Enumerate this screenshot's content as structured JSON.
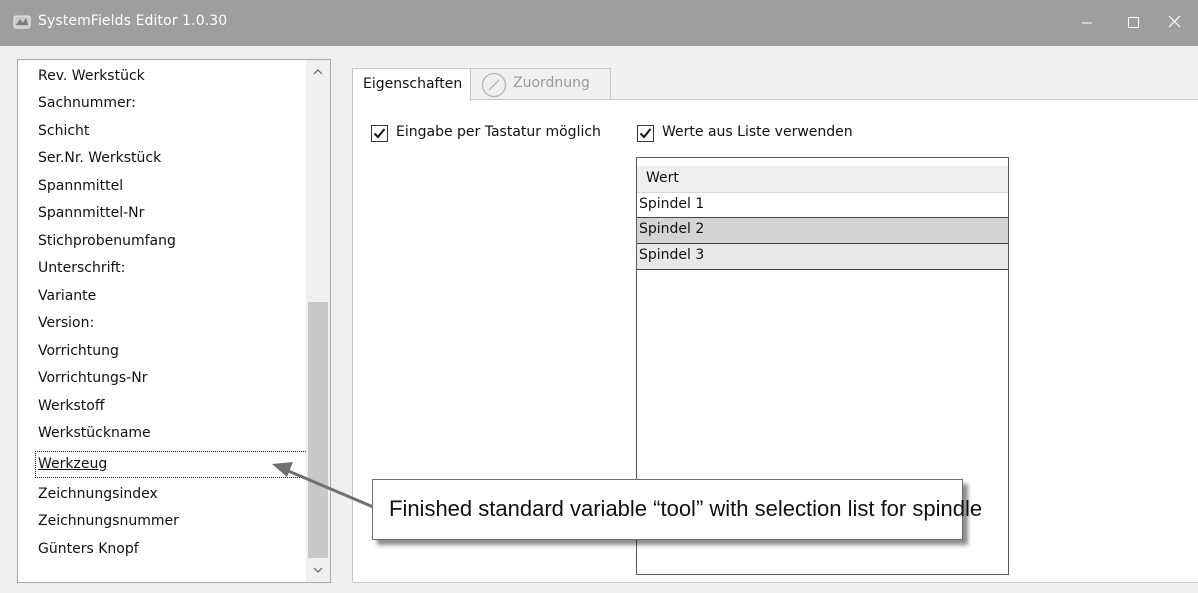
{
  "window": {
    "title": "SystemFields Editor 1.0.30",
    "minimize_glyph": "—",
    "maximize_glyph": "☐",
    "close_glyph": "✕"
  },
  "field_list": {
    "items": [
      "Rev. Werkstück",
      "Sachnummer:",
      "Schicht",
      "Ser.Nr. Werkstück",
      "Spannmittel",
      "Spannmittel-Nr",
      "Stichprobenumfang",
      "Unterschrift:",
      "Variante",
      "Version:",
      "Vorrichtung",
      "Vorrichtungs-Nr",
      "Werkstoff",
      "Werkstückname",
      "Werkzeug",
      "Zeichnungsindex",
      "Zeichnungsnummer",
      "Günters Knopf"
    ],
    "selected_item": "Werkzeug"
  },
  "tabs": {
    "properties_label": "Eigenschaften",
    "assignment_label": "Zuordnung",
    "assignment_icon": "edit-circle-icon"
  },
  "properties": {
    "keyboard_input": {
      "label": "Eingabe per Tastatur möglich",
      "checked": true
    },
    "use_list_values": {
      "label": "Werte aus Liste verwenden",
      "checked": true
    }
  },
  "values_table": {
    "header": "Wert",
    "rows": [
      "Spindel 1",
      "Spindel 2",
      "Spindel 3"
    ]
  },
  "annotation": {
    "text": "Finished standard variable “tool” with selection list for spindle"
  },
  "colors": {
    "titlebar": "#9e9e9e",
    "window_bg": "#f0f0f0",
    "selected_row": "#d4d4d4"
  }
}
